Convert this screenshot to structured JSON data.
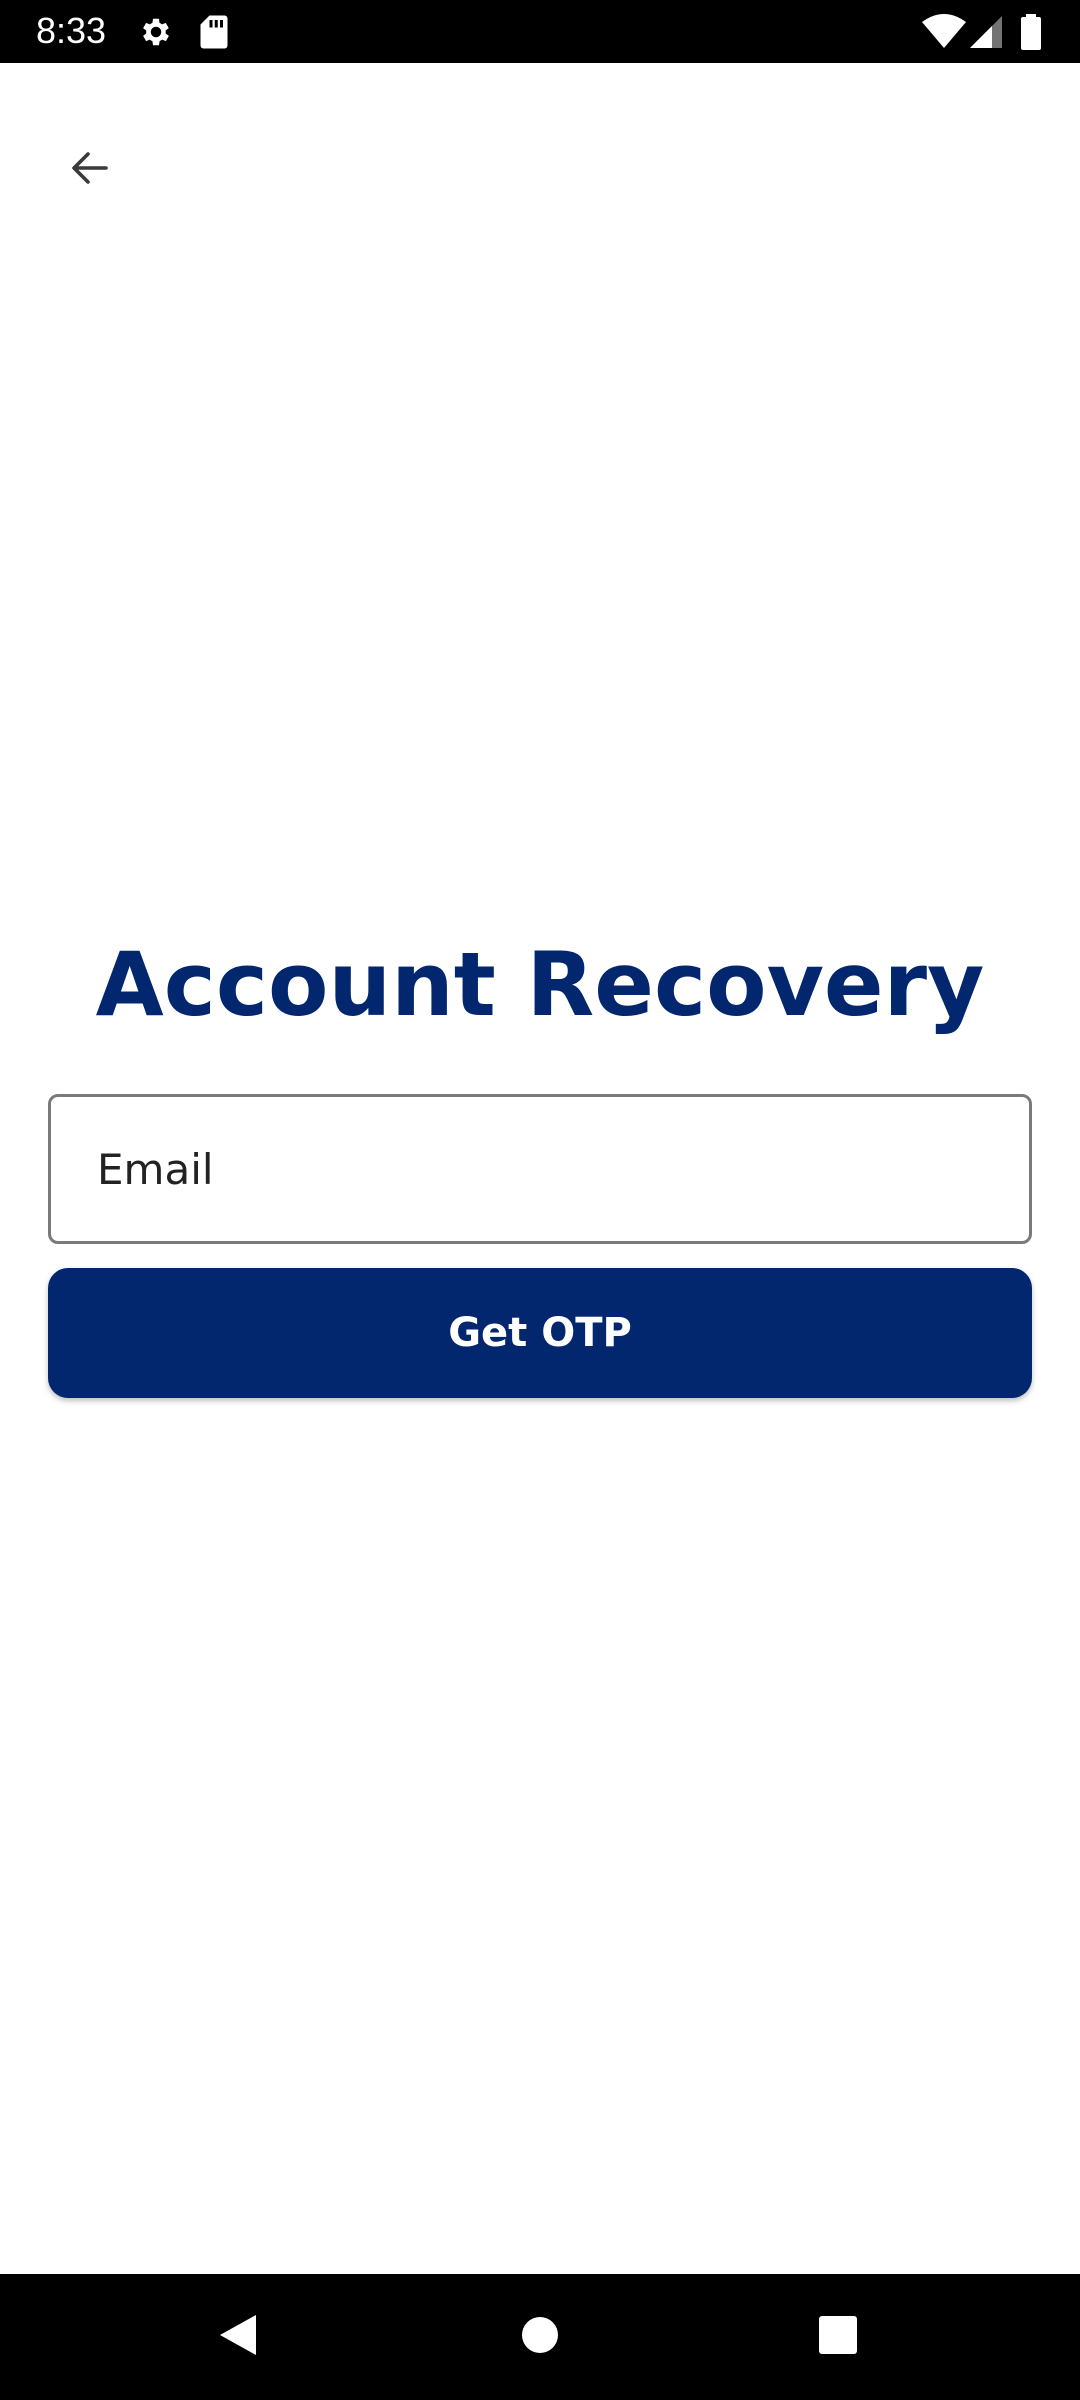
{
  "status_bar": {
    "time": "8:33",
    "icons": [
      "gear-icon",
      "sd-card-icon",
      "wifi-icon",
      "signal-icon",
      "battery-icon"
    ]
  },
  "header": {
    "back_icon": "arrow-back-icon"
  },
  "main": {
    "title": "Account Recovery",
    "email_placeholder": "Email",
    "email_value": "",
    "otp_button_label": "Get OTP"
  },
  "nav_bar": {
    "icons": [
      "nav-back-icon",
      "nav-home-icon",
      "nav-recents-icon"
    ]
  },
  "colors": {
    "primary": "#03276e",
    "background": "#ffffff",
    "system_bars": "#000000"
  }
}
